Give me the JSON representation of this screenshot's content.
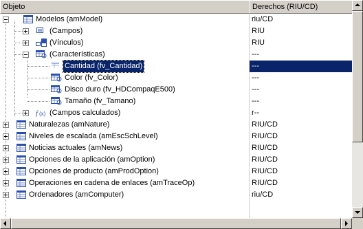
{
  "header": {
    "col_object": "Objeto",
    "col_rights": "Derechos (RIU/CD)"
  },
  "rows": [
    {
      "label": "Modelos (amModel)",
      "rights": "riu/CD",
      "icon": "table-icon"
    },
    {
      "label": "(Campos)",
      "rights": "RIU",
      "icon": "fields-icon"
    },
    {
      "label": "(Vínculos)",
      "rights": "RIU",
      "icon": "links-icon"
    },
    {
      "label": "(Características)",
      "rights": "---",
      "icon": "features-icon"
    },
    {
      "label": "Cantidad (fv_Cantidad)",
      "rights": "---",
      "icon": "feature-icon"
    },
    {
      "label": "Color (fv_Color)",
      "rights": "---",
      "icon": "feature-icon"
    },
    {
      "label": "Disco duro (fv_HDCompaqE500)",
      "rights": "---",
      "icon": "feature-icon"
    },
    {
      "label": "Tamaño (fv_Tamano)",
      "rights": "---",
      "icon": "feature-icon"
    },
    {
      "label": "(Campos calculados)",
      "rights": "r--",
      "icon": "function-icon"
    },
    {
      "label": "Naturalezas (amNature)",
      "rights": "RIU/CD",
      "icon": "table-icon"
    },
    {
      "label": "Niveles de escalada (amEscSchLevel)",
      "rights": "RIU/CD",
      "icon": "table-icon"
    },
    {
      "label": "Noticias actuales (amNews)",
      "rights": "RIU/CD",
      "icon": "table-icon"
    },
    {
      "label": "Opciones de la aplicación (amOption)",
      "rights": "RIU/CD",
      "icon": "table-icon"
    },
    {
      "label": "Opciones de producto (amProdOption)",
      "rights": "RIU/CD",
      "icon": "table-icon"
    },
    {
      "label": "Operaciones en cadena de enlaces (amTraceOp)",
      "rights": "RIU/CD",
      "icon": "table-icon"
    },
    {
      "label": "Ordenadores (amComputer)",
      "rights": "riu/CD",
      "icon": "table-icon"
    }
  ],
  "selected_row": "Cantidad (fv_Cantidad)",
  "colors": {
    "selection": "#0a246a",
    "header_bg": "#d4d0c8",
    "icon_blue": "#2a4fb0"
  }
}
